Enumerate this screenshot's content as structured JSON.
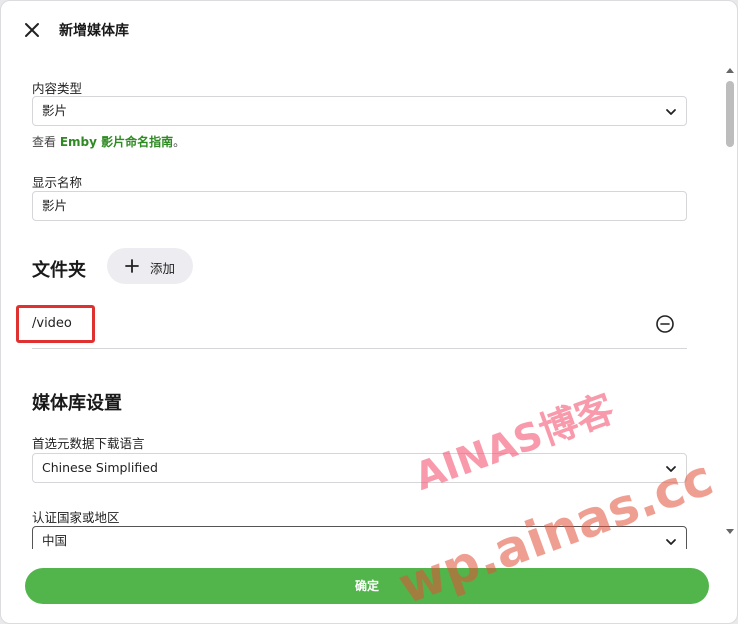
{
  "dialog": {
    "title": "新增媒体库",
    "close_icon": "close-icon"
  },
  "content_type": {
    "label": "内容类型",
    "value": "影片"
  },
  "naming_hint": {
    "prefix": "查看 ",
    "link": "Emby 影片命名指南",
    "suffix": "。"
  },
  "display_name": {
    "label": "显示名称",
    "value": "影片"
  },
  "folders": {
    "title": "文件夹",
    "add_label": "添加",
    "items": [
      "/video"
    ]
  },
  "library_settings": {
    "title": "媒体库设置",
    "metadata_language_label": "首选元数据下载语言",
    "metadata_language_value": "Chinese Simplified",
    "country_label": "认证国家或地区",
    "country_value": "中国"
  },
  "footer": {
    "confirm_label": "确定"
  },
  "watermark": {
    "line1": "AINAS博客",
    "line2": "wp.ainas.cc"
  },
  "colors": {
    "accent_green": "#52b54b",
    "link_green": "#2e8b22",
    "highlight_red": "#e03131"
  }
}
